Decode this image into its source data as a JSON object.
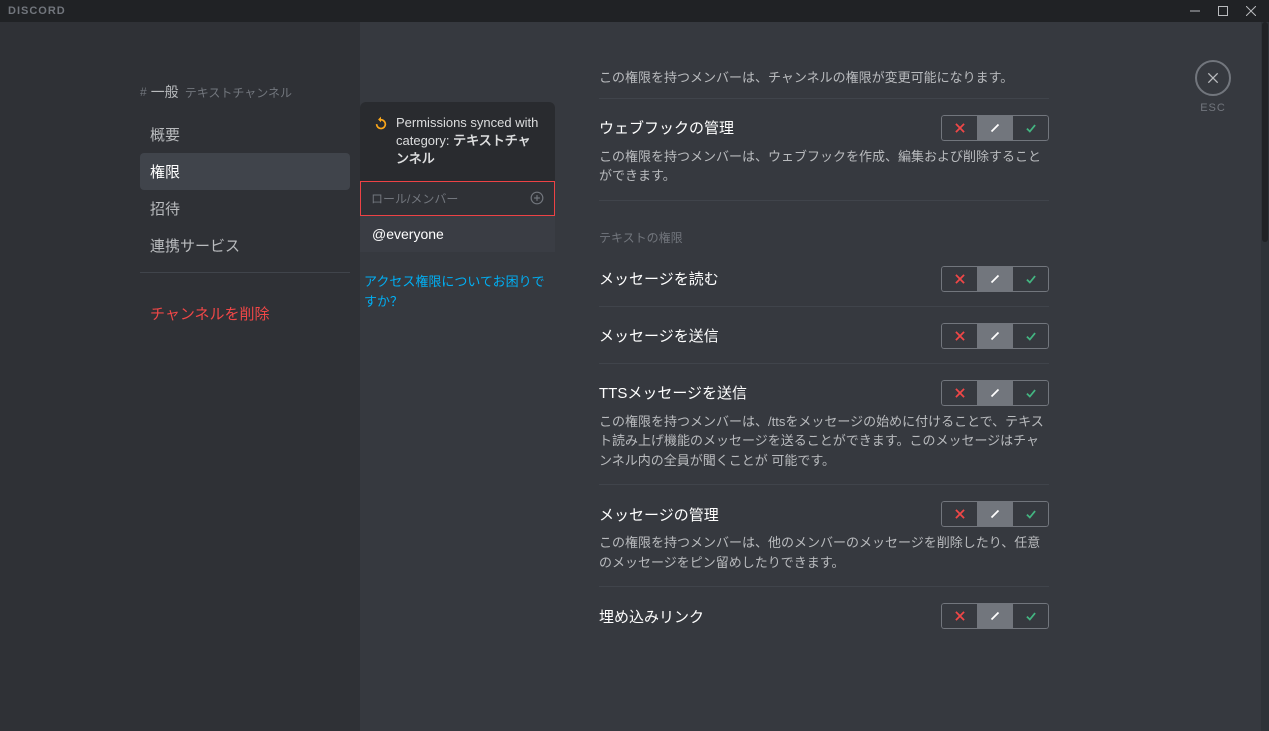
{
  "titlebar": {
    "brand": "DISCORD"
  },
  "sidebar": {
    "channel_hash": "#",
    "channel_name": "一般",
    "channel_sub": "テキストチャンネル",
    "items": [
      {
        "label": "概要",
        "active": false
      },
      {
        "label": "権限",
        "active": true
      },
      {
        "label": "招待",
        "active": false
      },
      {
        "label": "連携サービス",
        "active": false
      }
    ],
    "delete_label": "チャンネルを削除"
  },
  "roles_col": {
    "sync_prefix": "Permissions synced with category:",
    "sync_category": "テキストチャンネル",
    "roles_header": "ロール/メンバー",
    "role_everyone": "@everyone",
    "help_link": "アクセス権限についてお困りですか？"
  },
  "permissions": {
    "top_desc": "この権限を持つメンバーは、チャンネルの権限が変更可能になります。",
    "items": [
      {
        "title": "ウェブフックの管理",
        "desc": "この権限を持つメンバーは、ウェブフックを作成、編集および削除することができます。"
      }
    ],
    "text_section_title": "テキストの権限",
    "text_items": [
      {
        "title": "メッセージを読む",
        "desc": ""
      },
      {
        "title": "メッセージを送信",
        "desc": ""
      },
      {
        "title": "TTSメッセージを送信",
        "desc": "この権限を持つメンバーは、/ttsをメッセージの始めに付けることで、テキスト読み上げ機能のメッセージを送ることができます。このメッセージはチャンネル内の全員が聞くことが 可能です。"
      },
      {
        "title": "メッセージの管理",
        "desc": "この権限を持つメンバーは、他のメンバーのメッセージを削除したり、任意のメッセージをピン留めしたりできます。"
      },
      {
        "title": "埋め込みリンク",
        "desc": ""
      }
    ]
  },
  "esc_label": "ESC"
}
